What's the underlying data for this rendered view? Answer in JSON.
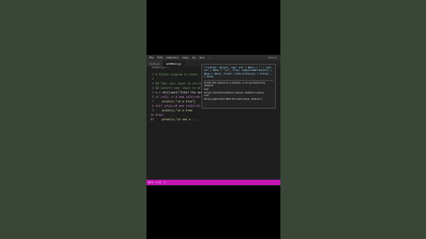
{
  "menu": {
    "items": [
      "File",
      "Edit",
      "Selection",
      "View",
      "Go",
      "Run",
      "..."
    ],
    "title": "Search"
  },
  "tabs": [
    {
      "label": "hello.py"
    },
    {
      "label": "addition.py"
    }
  ],
  "breadcrumb": "addition.py > ...",
  "code_lines": [
    {
      "num": "1",
      "text": "# Python program to check",
      "style": "comment"
    },
    {
      "num": "2",
      "text": "",
      "style": ""
    },
    {
      "num": "3",
      "text": "## Take user input to verify",
      "style": "comment"
    },
    {
      "num": "4",
      "text": "## Convert user input to an int",
      "style": "comment"
    },
    {
      "num": "5",
      "text": "x = int(input(\"Enter the number",
      "style": ""
    },
    {
      "num": "6",
      "text": "if (x%2) == 0 and (x%5)==0:",
      "style": "kw"
    },
    {
      "num": "7",
      "text": "    print(x,\"is a true\")",
      "style": "fn"
    },
    {
      "num": "8",
      "text": "elif (x%2)==0 and (x%5)!=0:",
      "style": "kw"
    },
    {
      "num": "9",
      "text": "    print(x,\"is a true",
      "style": "fn"
    },
    {
      "num": "10",
      "text": "else:",
      "style": "kw"
    },
    {
      "num": "11",
      "text": "    print(x,\"is not a ...",
      "style": "fn"
    }
  ],
  "hover": {
    "signature": "(*values: object, sep: str | None = \" \", end: str | None = \"\\n\", file: SupportsWrite[str] | None = None, flush: Literal[False] = False) -> None",
    "doc_lines": [
      "Prints the values to a stream, or to sys.stdout by default.",
      "sep",
      "  string inserted between values, default a space.",
      "end",
      "  string appended after the last value, default a"
    ]
  },
  "status": {
    "items": [
      "⊗ 0",
      "⚠ 0",
      "⚡"
    ]
  }
}
